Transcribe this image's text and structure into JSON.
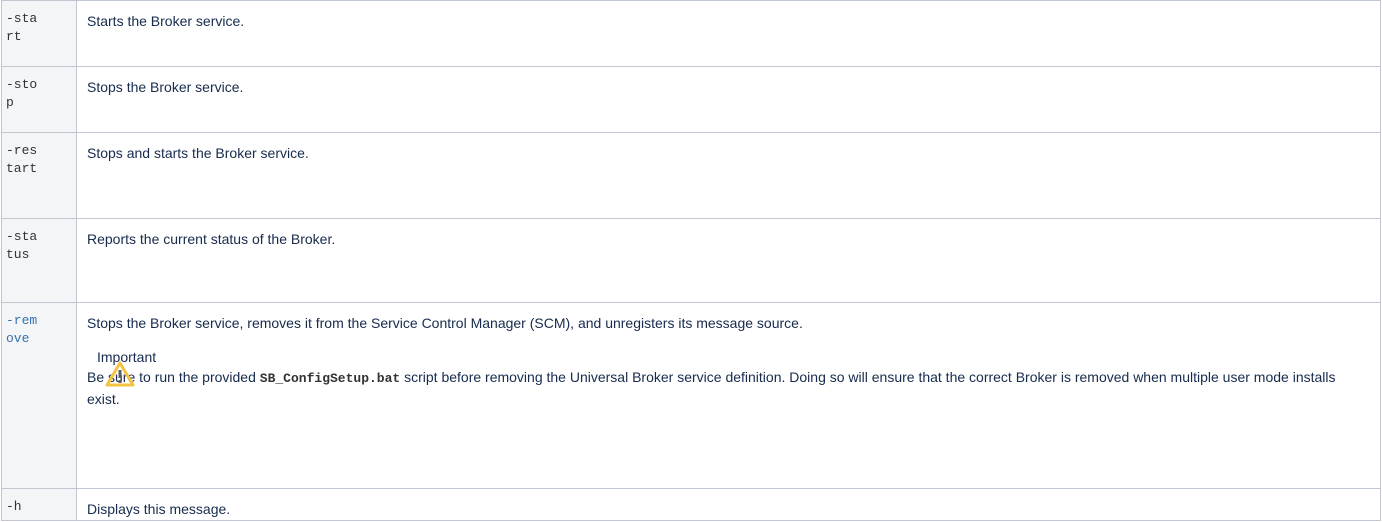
{
  "rows": [
    {
      "option": "-start",
      "description": "Starts the Broker service."
    },
    {
      "option": "-stop",
      "description": "Stops the Broker service."
    },
    {
      "option": "-restart",
      "description": "Stops and starts the Broker service."
    },
    {
      "option": "-status",
      "description": "Reports the current status of the Broker."
    },
    {
      "option": "-remove",
      "description": "Stops the Broker service, removes it from the Service Control Manager (SCM), and unregisters its message source.",
      "warning": {
        "title": "Important",
        "text_before": "Be sure to run the provided ",
        "file": "SB_ConfigSetup.bat",
        "text_after": " script before removing the Universal Broker service definition.  Doing so will ensure that the correct Broker is removed when multiple user mode installs exist."
      }
    },
    {
      "option": "-h",
      "description": "Displays this message."
    }
  ],
  "colors": {
    "border": "#c1c7d0",
    "option_bg": "#f4f5f7",
    "link": "#3572b0",
    "warning_icon": "#f5c342"
  }
}
